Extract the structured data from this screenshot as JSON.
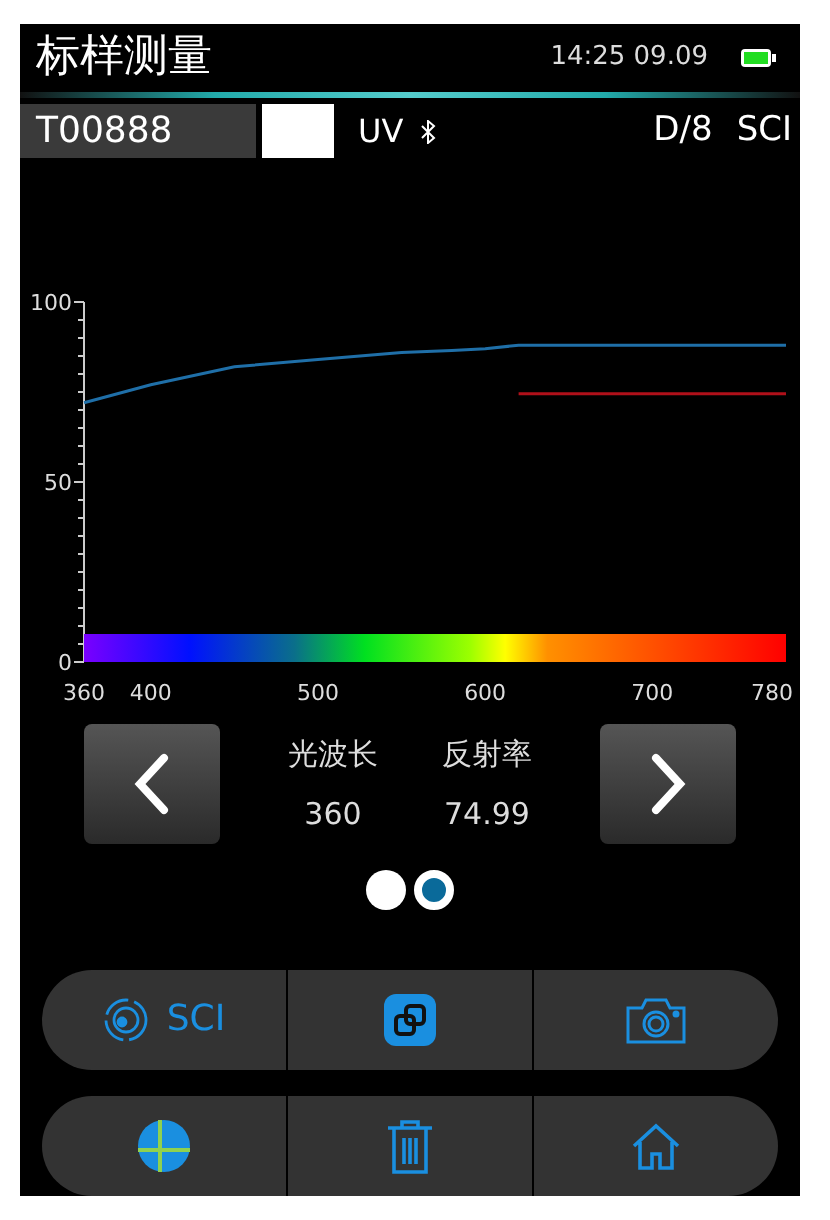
{
  "header": {
    "title": "标样测量",
    "time": "14:25 09.09"
  },
  "info_bar": {
    "sample_id": "T00888",
    "uv": "UV",
    "geometry": "D/8",
    "mode": "SCI"
  },
  "chart": {
    "chart_data": {
      "type": "line",
      "x": [
        360,
        400,
        450,
        500,
        550,
        580,
        600,
        620,
        700,
        780
      ],
      "series": [
        {
          "color": "#1f6fa8",
          "values": [
            72,
            77,
            82,
            84,
            86,
            86.5,
            87,
            88,
            88,
            88
          ]
        },
        {
          "color": "#b0101a",
          "values": [
            null,
            null,
            null,
            null,
            null,
            null,
            null,
            74.5,
            74.5,
            74.5
          ]
        }
      ],
      "xlim": [
        360,
        780
      ],
      "ylim": [
        0,
        100
      ],
      "xticks": [
        360,
        400,
        500,
        600,
        700,
        780
      ],
      "yticks": [
        0,
        50,
        100
      ]
    }
  },
  "readout": {
    "wavelength_label": "光波长",
    "wavelength": "360",
    "reflectance_label": "反射率",
    "reflectance": "74.99"
  },
  "page_dots": [
    {
      "selected": false
    },
    {
      "selected": true
    }
  ],
  "toolbar_rows": [
    [
      {
        "kind": "mode",
        "label": "SCI"
      },
      {
        "kind": "link"
      },
      {
        "kind": "camera"
      }
    ],
    [
      {
        "kind": "target"
      },
      {
        "kind": "trash"
      },
      {
        "kind": "home"
      }
    ]
  ]
}
